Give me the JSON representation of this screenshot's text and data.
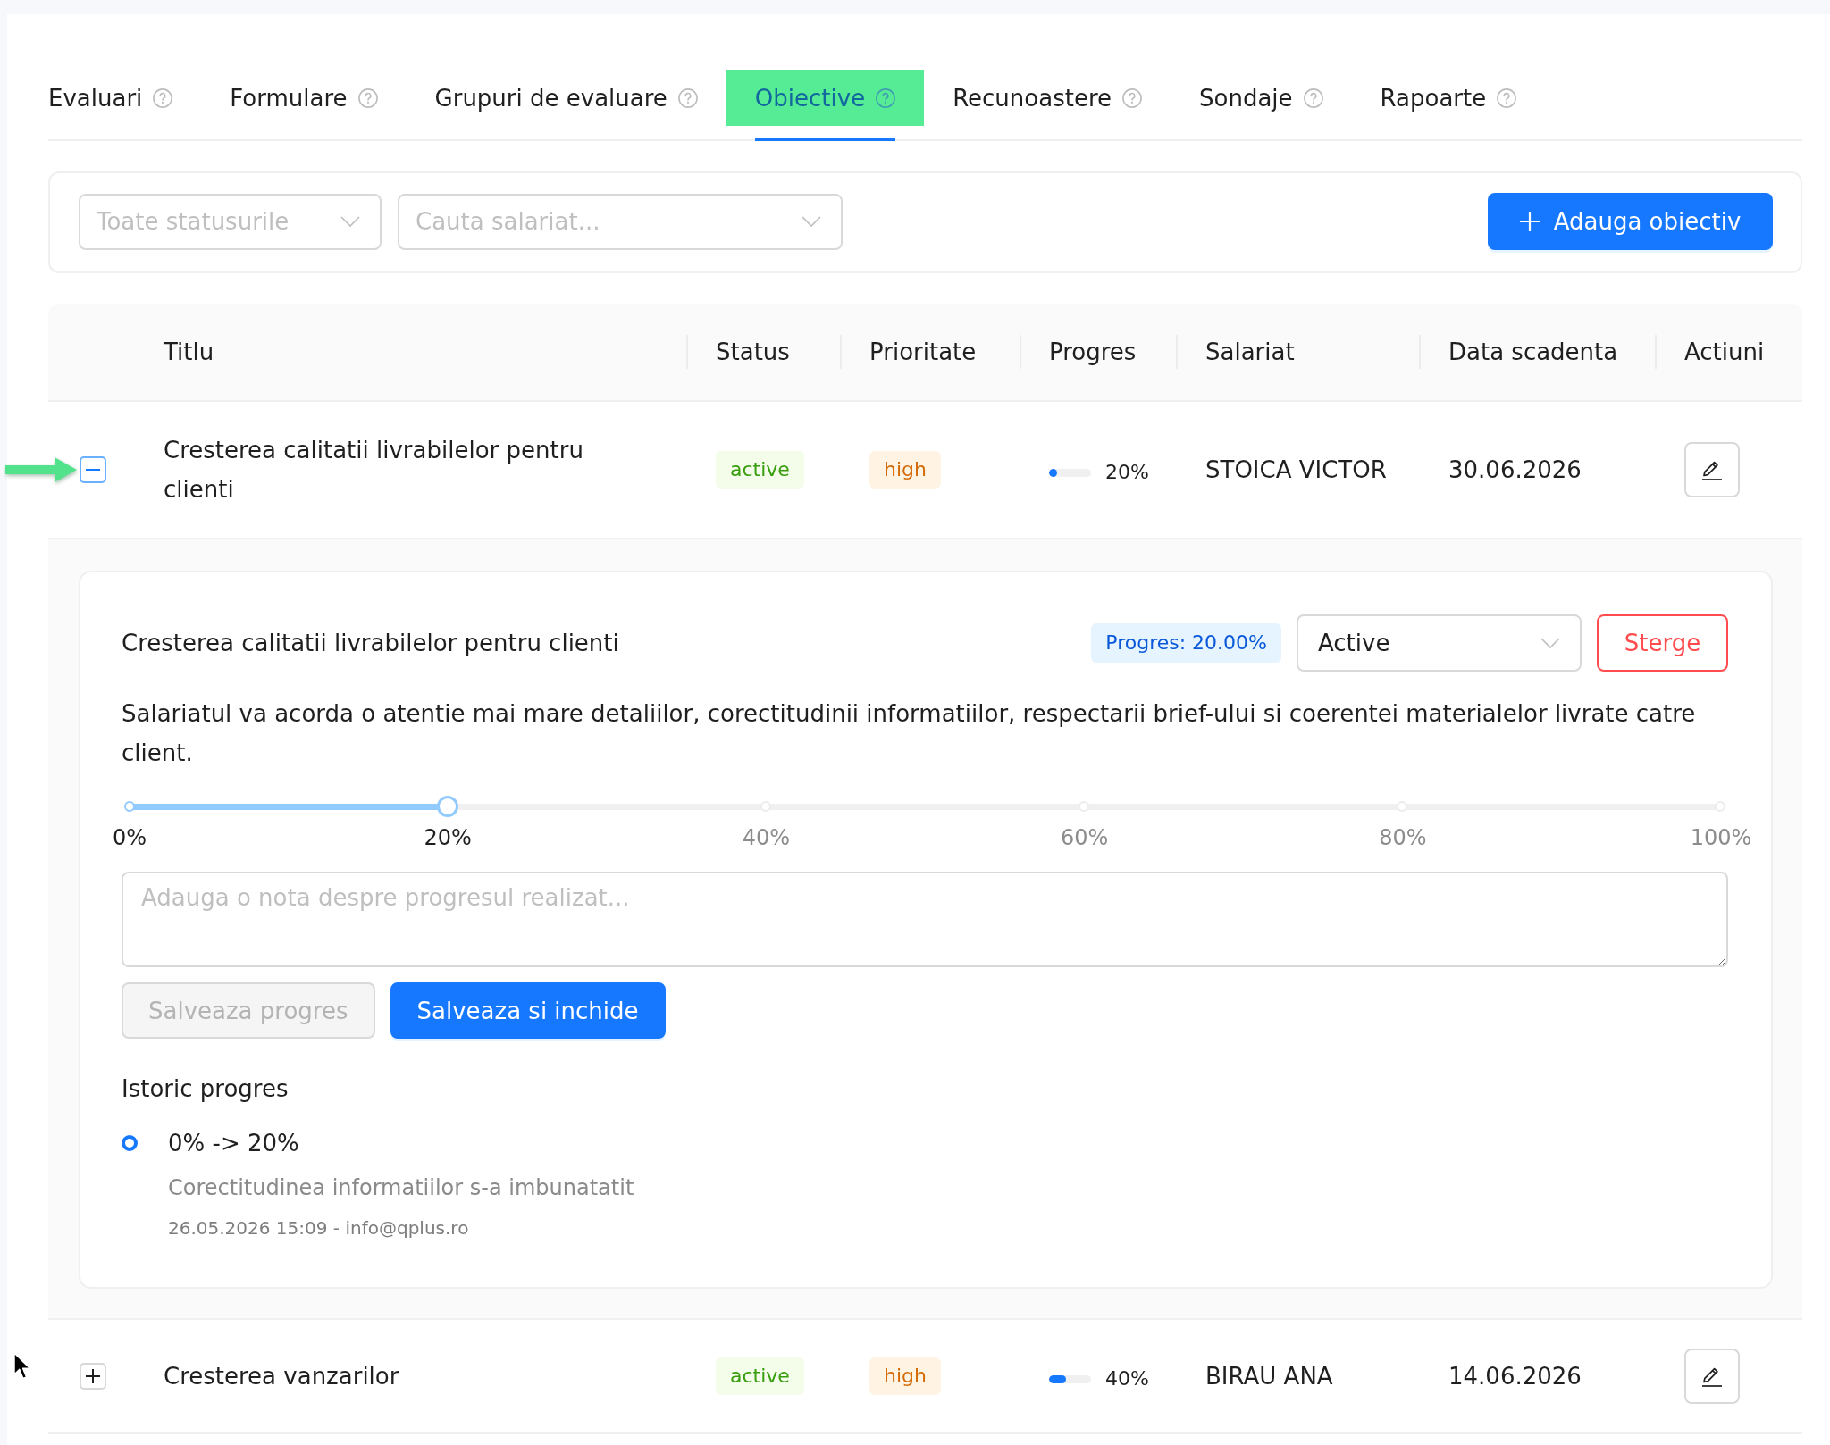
{
  "tabs": [
    {
      "label": "Evaluari",
      "selected": false
    },
    {
      "label": "Formulare",
      "selected": false
    },
    {
      "label": "Grupuri de evaluare",
      "selected": false
    },
    {
      "label": "Obiective",
      "selected": true
    },
    {
      "label": "Recunoastere",
      "selected": false
    },
    {
      "label": "Sondaje",
      "selected": false
    },
    {
      "label": "Rapoarte",
      "selected": false
    }
  ],
  "filters": {
    "status_select": {
      "placeholder": "Toate statusurile"
    },
    "employee_select": {
      "placeholder": "Cauta salariat..."
    },
    "add_button": {
      "label": "Adauga obiectiv"
    }
  },
  "table": {
    "columns": [
      "Titlu",
      "Status",
      "Prioritate",
      "Progres",
      "Salariat",
      "Data scadenta",
      "Actiuni"
    ],
    "rows": [
      {
        "expanded": true,
        "title": "Cresterea calitatii livrabilelor pentru clienti",
        "status": "active",
        "priority": "high",
        "progress": {
          "level": 0.2,
          "reading": "20%"
        },
        "employee": "STOICA VICTOR",
        "due_date": "30.06.2026",
        "detail": {
          "title": "Cresterea calitatii livrabilelor pentru clienti",
          "progress_tag": "Progres: 20.00%",
          "status_select": {
            "value": "Active"
          },
          "delete_button": "Sterge",
          "description": "Salariatul va acorda o atentie mai mare detaliilor, corectitudinii informatiilor, respectarii brief-ului si coerentei materialelor livrate catre client.",
          "slider": {
            "level": 0.2,
            "marks": [
              "0%",
              "20%",
              "40%",
              "60%",
              "80%",
              "100%"
            ]
          },
          "note_field": {
            "placeholder": "Adauga o nota despre progresul realizat..."
          },
          "buttons": [
            {
              "label": "Salveaza progres",
              "kind": "default",
              "disabled": true
            },
            {
              "label": "Salveaza si inchide",
              "kind": "primary",
              "disabled": false
            }
          ],
          "history": {
            "title": "Istoric progres",
            "entries": [
              {
                "change": "0% -> 20%",
                "comment": "Corectitudinea informatiilor s-a imbunatatit",
                "meta": "26.05.2026 15:09 - info@qplus.ro"
              }
            ]
          }
        }
      },
      {
        "expanded": false,
        "title": "Cresterea vanzarilor",
        "status": "active",
        "priority": "high",
        "progress": {
          "level": 0.4,
          "reading": "40%"
        },
        "employee": "BIRAU ANA",
        "due_date": "14.06.2026"
      }
    ]
  }
}
